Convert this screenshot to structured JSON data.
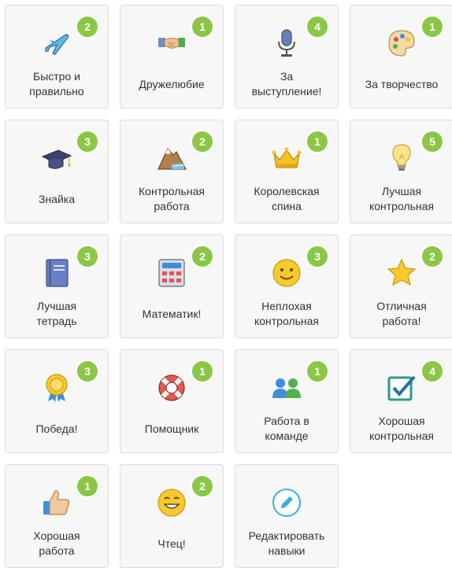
{
  "colors": {
    "badge": "#8bc745",
    "card_background": "#f7f7f7",
    "card_border": "#dcdcdc",
    "edit_accent": "#3aaee0"
  },
  "skills": [
    {
      "label": "Быстро и\nправильно",
      "count": "2",
      "icon": "airplane-icon"
    },
    {
      "label": "Дружелюбие",
      "count": "1",
      "icon": "handshake-icon"
    },
    {
      "label": "За\nвыступление!",
      "count": "4",
      "icon": "microphone-icon"
    },
    {
      "label": "За творчество",
      "count": "1",
      "icon": "palette-icon"
    },
    {
      "label": "Знайка",
      "count": "3",
      "icon": "graduation-cap-icon"
    },
    {
      "label": "Контрольная\nработа",
      "count": "2",
      "icon": "mountain-icon"
    },
    {
      "label": "Королевская\nспина",
      "count": "1",
      "icon": "crown-icon"
    },
    {
      "label": "Лучшая\nконтрольная",
      "count": "5",
      "icon": "lightbulb-icon"
    },
    {
      "label": "Лучшая\nтетрадь",
      "count": "3",
      "icon": "notebook-icon"
    },
    {
      "label": "Математик!",
      "count": "2",
      "icon": "calculator-icon"
    },
    {
      "label": "Неплохая\nконтрольная",
      "count": "3",
      "icon": "smiley-icon"
    },
    {
      "label": "Отличная\nработа!",
      "count": "2",
      "icon": "star-icon"
    },
    {
      "label": "Победа!",
      "count": "3",
      "icon": "medal-icon"
    },
    {
      "label": "Помощник",
      "count": "1",
      "icon": "lifebuoy-icon"
    },
    {
      "label": "Работа в\nкоманде",
      "count": "1",
      "icon": "team-icon"
    },
    {
      "label": "Хорошая\nконтрольная",
      "count": "4",
      "icon": "checkbox-icon"
    },
    {
      "label": "Хорошая\nработа",
      "count": "1",
      "icon": "thumbs-up-icon"
    },
    {
      "label": "Чтец!",
      "count": "2",
      "icon": "reader-face-icon"
    }
  ],
  "edit": {
    "label": "Редактировать\nнавыки",
    "icon": "pencil-icon"
  }
}
